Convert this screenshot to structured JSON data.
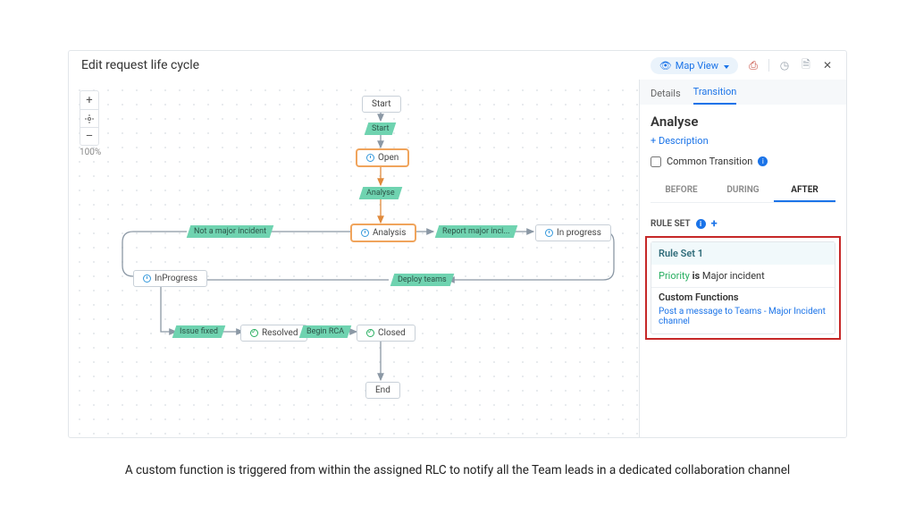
{
  "header": {
    "title": "Edit request life cycle",
    "mapview_label": "Map View"
  },
  "zoom": {
    "plus": "+",
    "minus": "–",
    "percent": "100%"
  },
  "nodes": {
    "start": "Start",
    "open": "Open",
    "analysis": "Analysis",
    "in_progress_right": "In progress",
    "in_progress_left": "InProgress",
    "resolved": "Resolved",
    "closed": "Closed",
    "end": "End"
  },
  "transitions": {
    "start": "Start",
    "analyse": "Analyse",
    "not_major": "Not a major incident",
    "report_major": "Report major inci...",
    "deploy_teams": "Deploy teams",
    "issue_fixed": "Issue fixed",
    "begin_rca": "Begin RCA"
  },
  "panel": {
    "tab_details": "Details",
    "tab_transition": "Transition",
    "title": "Analyse",
    "add_description": "+ Description",
    "common_transition": "Common Transition",
    "before": "BEFORE",
    "during": "DURING",
    "after": "AFTER",
    "ruleset_header": "RULE SET",
    "ruleset": {
      "title": "Rule Set 1",
      "condition_field": "Priority",
      "condition_op": "is",
      "condition_value": "Major incident",
      "functions_header": "Custom Functions",
      "function_link": "Post a message to Teams - Major Incident channel"
    }
  },
  "caption": "A custom function is triggered from within the assigned RLC to notify all the Team leads in a dedicated collaboration channel"
}
